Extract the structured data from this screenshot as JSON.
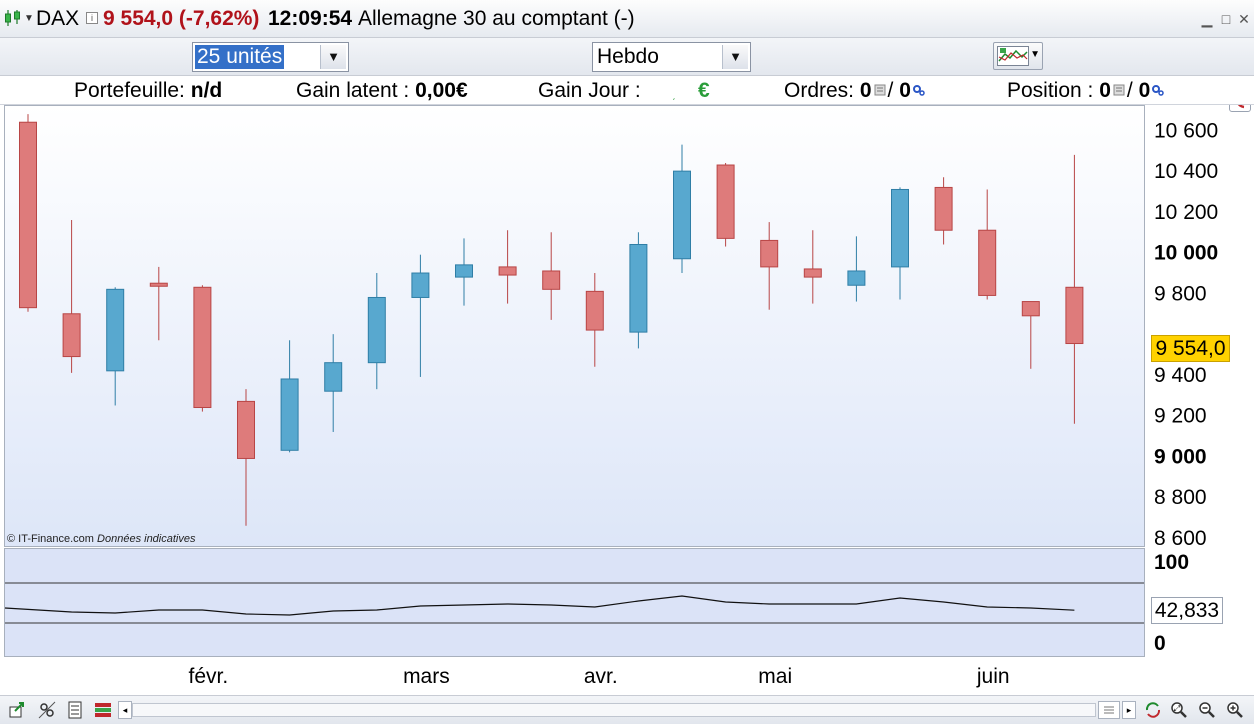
{
  "title_bar": {
    "symbol": "DAX",
    "price_change": "9 554,0 (-7,62%)",
    "time": "12:09:54",
    "instrument_name": "Allemagne 30 au comptant (-)"
  },
  "toolbar": {
    "quantity": "25 unités",
    "period": "Hebdo"
  },
  "stats": {
    "portfolio_label": "Portefeuille:",
    "portfolio_value": "n/d",
    "latent_gain_label": "Gain latent :",
    "latent_gain_value": "0,00€",
    "day_gain_label": "Gain Jour :",
    "day_gain_value": "€",
    "orders_label": "Ordres:",
    "orders_value1": "0",
    "orders_sep": "/",
    "orders_value2": "0",
    "position_label": "Position :",
    "position_value1": "0",
    "position_sep": "/",
    "position_value2": "0"
  },
  "chart": {
    "watermark": "© IT-Finance.com",
    "watermark_note": "Données indicatives",
    "current_price": "9 554,0",
    "indicator_value": "42,833",
    "colors": {
      "up": "#58a8cf",
      "down": "#de7b7b",
      "up_edge": "#2f7ea6",
      "down_edge": "#b84545"
    }
  },
  "chart_data": {
    "type": "candlestick",
    "period": "weekly",
    "y_axis": {
      "ticks": [
        8600,
        8800,
        9000,
        9200,
        9400,
        9800,
        10000,
        10200,
        10400,
        10600
      ],
      "tick_labels": [
        "8 600",
        "8 800",
        "9 000",
        "9 200",
        "9 400",
        "9 800",
        "10 000",
        "10 200",
        "10 400",
        "10 600"
      ],
      "bold_ticks": [
        9000,
        10000
      ],
      "ylim": [
        8580,
        10700
      ]
    },
    "x_axis_labels": [
      {
        "label": "févr.",
        "index": 4
      },
      {
        "label": "mars",
        "index": 9
      },
      {
        "label": "avr.",
        "index": 13
      },
      {
        "label": "mai",
        "index": 17
      },
      {
        "label": "juin",
        "index": 22
      }
    ],
    "candles": [
      {
        "o": 10640,
        "h": 10680,
        "l": 9710,
        "c": 9730
      },
      {
        "o": 9700,
        "h": 10160,
        "l": 9410,
        "c": 9490
      },
      {
        "o": 9420,
        "h": 9830,
        "l": 9250,
        "c": 9820
      },
      {
        "o": 9850,
        "h": 9930,
        "l": 9570,
        "c": 9835
      },
      {
        "o": 9830,
        "h": 9840,
        "l": 9220,
        "c": 9240
      },
      {
        "o": 9270,
        "h": 9330,
        "l": 8660,
        "c": 8990
      },
      {
        "o": 9030,
        "h": 9570,
        "l": 9020,
        "c": 9380
      },
      {
        "o": 9320,
        "h": 9600,
        "l": 9120,
        "c": 9460
      },
      {
        "o": 9460,
        "h": 9900,
        "l": 9330,
        "c": 9780
      },
      {
        "o": 9780,
        "h": 9990,
        "l": 9390,
        "c": 9900
      },
      {
        "o": 9880,
        "h": 10070,
        "l": 9740,
        "c": 9940
      },
      {
        "o": 9930,
        "h": 10110,
        "l": 9750,
        "c": 9890
      },
      {
        "o": 9910,
        "h": 10100,
        "l": 9670,
        "c": 9820
      },
      {
        "o": 9810,
        "h": 9900,
        "l": 9440,
        "c": 9620
      },
      {
        "o": 9610,
        "h": 10100,
        "l": 9530,
        "c": 10040
      },
      {
        "o": 9970,
        "h": 10530,
        "l": 9900,
        "c": 10400
      },
      {
        "o": 10430,
        "h": 10440,
        "l": 10030,
        "c": 10070
      },
      {
        "o": 10060,
        "h": 10150,
        "l": 9720,
        "c": 9930
      },
      {
        "o": 9920,
        "h": 10110,
        "l": 9750,
        "c": 9880
      },
      {
        "o": 9840,
        "h": 10080,
        "l": 9760,
        "c": 9910
      },
      {
        "o": 9930,
        "h": 10320,
        "l": 9770,
        "c": 10310
      },
      {
        "o": 10320,
        "h": 10370,
        "l": 10040,
        "c": 10110
      },
      {
        "o": 10110,
        "h": 10310,
        "l": 9770,
        "c": 9790
      },
      {
        "o": 9760,
        "h": 9760,
        "l": 9430,
        "c": 9690
      },
      {
        "o": 9830,
        "h": 10480,
        "l": 9160,
        "c": 9554
      }
    ],
    "indicator": {
      "scale_labels": [
        "100",
        "0"
      ],
      "current": 42.833,
      "levels": [
        70,
        30
      ],
      "values": [
        45,
        41,
        40,
        43,
        43,
        39,
        38,
        42,
        43,
        47,
        48,
        49,
        48,
        46,
        52,
        57,
        51,
        49,
        49,
        49,
        55,
        51,
        46,
        45,
        42.8
      ]
    }
  },
  "statusbar": {
    "scroll_left": "◂",
    "scroll_right": "▸"
  }
}
